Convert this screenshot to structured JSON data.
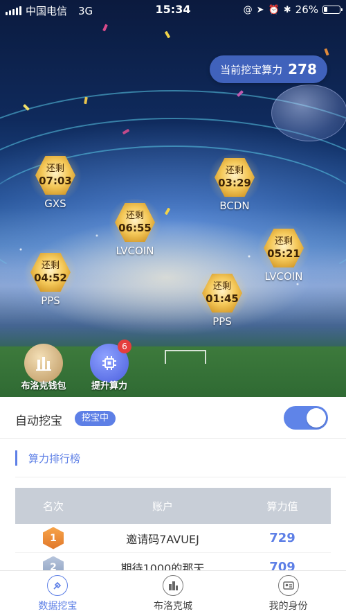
{
  "status_bar": {
    "carrier": "中国电信",
    "network": "3G",
    "time": "15:34",
    "battery": "26%",
    "battery_level": 0.26
  },
  "hero": {
    "power_label": "当前挖宝算力",
    "power_value": "278"
  },
  "coins": [
    {
      "remain": "还剩",
      "time": "07:03",
      "name": "GXS"
    },
    {
      "remain": "还剩",
      "time": "03:29",
      "name": "BCDN"
    },
    {
      "remain": "还剩",
      "time": "06:55",
      "name": "LVCOIN"
    },
    {
      "remain": "还剩",
      "time": "05:21",
      "name": "LVCOIN"
    },
    {
      "remain": "还剩",
      "time": "04:52",
      "name": "PPS"
    },
    {
      "remain": "还剩",
      "time": "01:45",
      "name": "PPS"
    }
  ],
  "actions": {
    "wallet_label": "布洛克钱包",
    "boost_label": "提升算力",
    "boost_badge": "6"
  },
  "auto_mine": {
    "title": "自动挖宝",
    "status_tag": "挖宝中",
    "enabled": true
  },
  "ranking": {
    "title": "算力排行榜",
    "headers": [
      "名次",
      "账户",
      "算力值"
    ],
    "rows": [
      {
        "rank": "1",
        "account": "邀请码7AVUEJ",
        "value": "729"
      },
      {
        "rank": "2",
        "account": "期待1000的那天",
        "value": "709"
      }
    ]
  },
  "tabs": [
    {
      "label": "数据挖宝",
      "icon": "shovel-icon",
      "active": true
    },
    {
      "label": "布洛克城",
      "icon": "city-icon",
      "active": false
    },
    {
      "label": "我的身份",
      "icon": "id-card-icon",
      "active": false
    }
  ],
  "colors": {
    "accent": "#5d7fe6",
    "coin_gold": "#f5c95a",
    "badge_red": "#e53d3d"
  }
}
